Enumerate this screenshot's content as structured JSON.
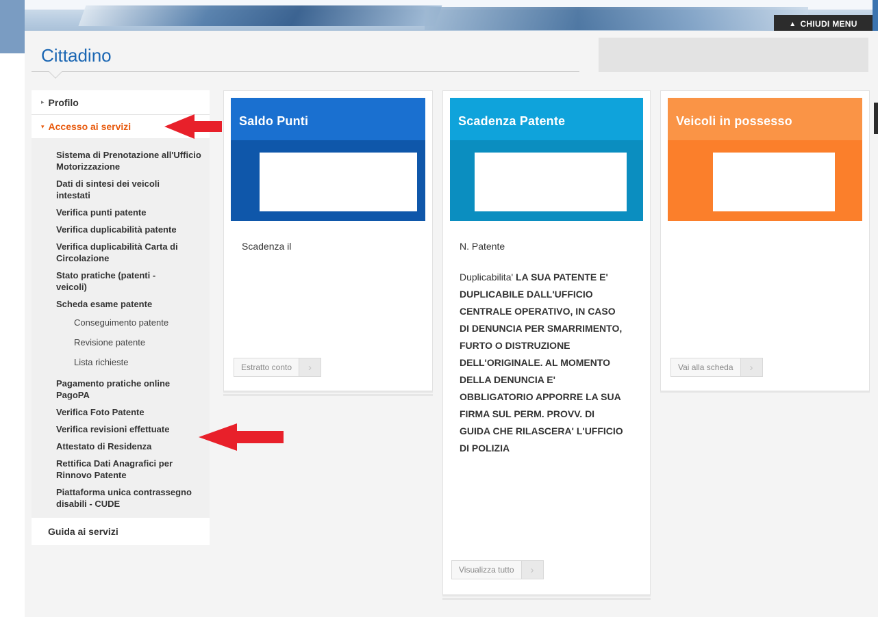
{
  "header": {
    "close_menu_label": "CHIUDI MENU",
    "page_title": "Cittadino"
  },
  "sidebar": {
    "top_item": "Profilo",
    "active_item": "Accesso ai servizi",
    "items": [
      {
        "label": "Sistema di Prenotazione all'Ufficio Motorizzazione",
        "level": 1
      },
      {
        "label": "Dati di sintesi dei veicoli intestati",
        "level": 1
      },
      {
        "label": "Verifica punti patente",
        "level": 1
      },
      {
        "label": "Verifica duplicabilità patente",
        "level": 1
      },
      {
        "label": "Verifica duplicabilità Carta di Circolazione",
        "level": 1
      },
      {
        "label": "Stato pratiche (patenti - veicoli)",
        "level": 1
      },
      {
        "label": "Scheda esame patente",
        "level": 1
      },
      {
        "label": "Conseguimento patente",
        "level": 2
      },
      {
        "label": "Revisione patente",
        "level": 2
      },
      {
        "label": "Lista richieste",
        "level": 2
      },
      {
        "label": "Pagamento pratiche online PagoPA",
        "level": 1
      },
      {
        "label": "Verifica Foto Patente",
        "level": 1
      },
      {
        "label": "Verifica revisioni effettuate",
        "level": 1
      },
      {
        "label": "Attestato di Residenza",
        "level": 1
      },
      {
        "label": "Rettifica Dati Anagrafici per Rinnovo Patente",
        "level": 1
      },
      {
        "label": "Piattaforma unica contrassegno disabili - CUDE",
        "level": 1
      }
    ],
    "bottom_item": "Guida ai servizi"
  },
  "cards": {
    "saldo": {
      "title": "Saldo Punti",
      "text": "Scadenza il",
      "button": "Estratto conto",
      "color_head": "#1a70d0",
      "color_band": "#0f57aa"
    },
    "scadenza": {
      "title": "Scadenza Patente",
      "text1": "N. Patente",
      "dup_label": "Duplicabilita'",
      "dup_text": "LA SUA PATENTE E' DUPLICABILE DALL'UFFICIO CENTRALE OPERATIVO, IN CASO DI DENUNCIA PER SMARRIMENTO, FURTO O DISTRUZIONE DELL'ORIGINALE. AL MOMENTO DELLA DENUNCIA E' OBBLIGATORIO APPORRE LA SUA FIRMA SUL PERM. PROVV. DI GUIDA CHE RILASCERA' L'UFFICIO DI POLIZIA",
      "button": "Visualizza tutto",
      "color_head": "#0fa3db",
      "color_band": "#0b8ec0"
    },
    "veicoli": {
      "title": "Veicoli in possesso",
      "button": "Vai alla scheda",
      "color_head": "#fa9446",
      "color_band": "#fb7f2b"
    }
  },
  "annotations": {
    "arrow_color": "#e8202a",
    "arrows": [
      "pointing to Accesso ai servizi",
      "pointing to Pagamento pratiche online PagoPA"
    ]
  }
}
